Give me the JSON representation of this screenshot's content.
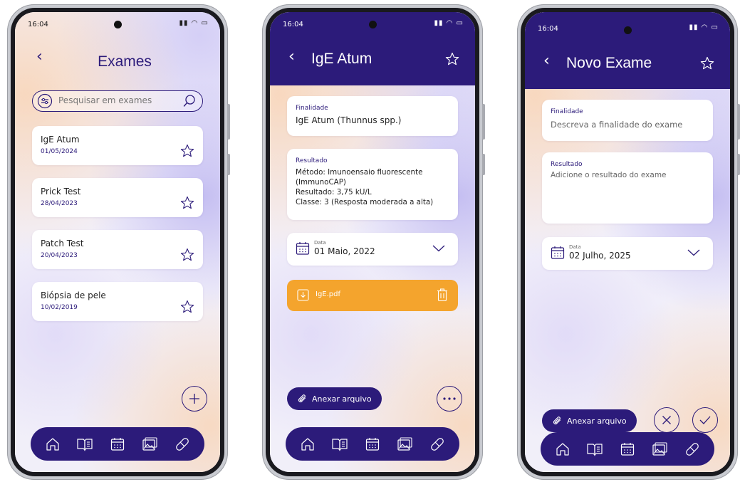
{
  "status": {
    "time": "16:04"
  },
  "screen1": {
    "title": "Exames",
    "search_placeholder": "Pesquisar em exames",
    "exams": [
      {
        "name": "IgE Atum",
        "date": "01/05/2024"
      },
      {
        "name": "Prick Test",
        "date": "28/04/2023"
      },
      {
        "name": "Patch Test",
        "date": "20/04/2023"
      },
      {
        "name": "Biópsia de pele",
        "date": "10/02/2019"
      }
    ]
  },
  "screen2": {
    "title": "IgE Atum",
    "finalidade_label": "Finalidade",
    "finalidade_value": "IgE Atum (Thunnus spp.)",
    "resultado_label": "Resultado",
    "resultado_lines": [
      "Método: Imunoensaio fluorescente",
      "(ImmunoCAP)",
      "Resultado: 3,75 kU/L",
      "Classe: 3 (Resposta moderada a alta)"
    ],
    "data_label": "Data",
    "data_value": "01 Maio, 2022",
    "file_name": "IgE.pdf",
    "attach_label": "Anexar arquivo"
  },
  "screen3": {
    "title": "Novo Exame",
    "finalidade_label": "Finalidade",
    "finalidade_placeholder": "Descreva a finalidade do exame",
    "resultado_label": "Resultado",
    "resultado_placeholder": "Adicione o resultado do exame",
    "data_label": "Data",
    "data_value": "02 Julho, 2025",
    "attach_label": "Anexar arquivo"
  },
  "colors": {
    "primary": "#2c1b7a",
    "accent": "#f4a42d",
    "background": "#efedf9"
  },
  "icons": [
    "home-icon",
    "book-icon",
    "calendar-icon",
    "gallery-icon",
    "pill-icon"
  ]
}
